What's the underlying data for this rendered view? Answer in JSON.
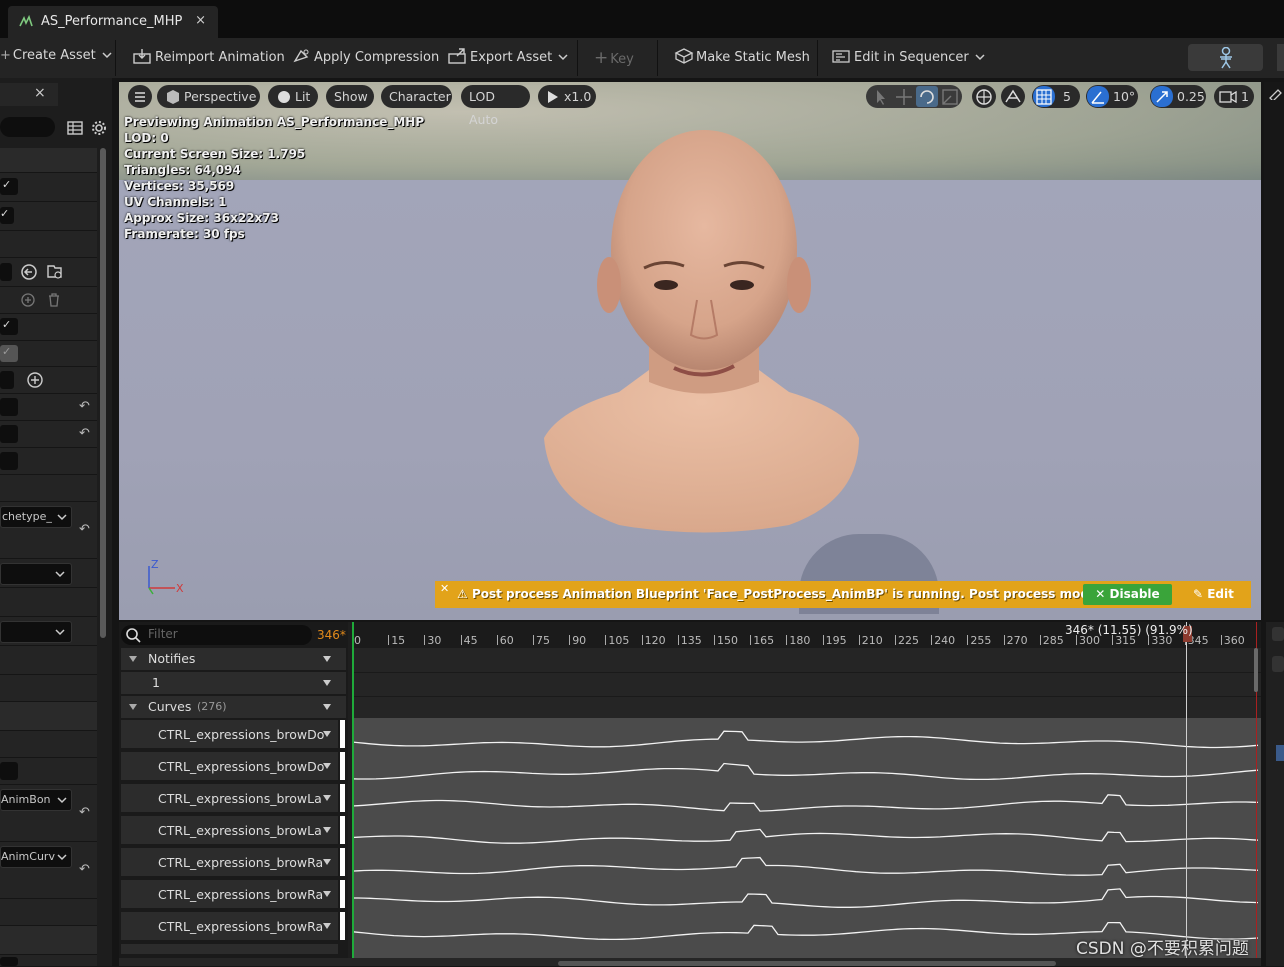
{
  "tab": {
    "title": "AS_Performance_MHP",
    "close": "×"
  },
  "toolbar": {
    "create_asset": "Create Asset",
    "reimport": "Reimport Animation",
    "apply_compression": "Apply Compression",
    "export_asset": "Export Asset",
    "key": "Key",
    "make_static_mesh": "Make Static Mesh",
    "edit_in_sequencer": "Edit in Sequencer"
  },
  "left_panel": {
    "close": "×",
    "dropdown_archetype": "chetype_",
    "dropdown_animbone": "AnimBon ",
    "dropdown_animcurve": "AnimCurv"
  },
  "viewport": {
    "buttons": {
      "perspective": "Perspective",
      "lit": "Lit",
      "show": "Show",
      "character": "Character",
      "lod": "LOD Auto",
      "speed": "x1.0"
    },
    "right_controls": {
      "grid_value": "5",
      "angle_value": "10°",
      "scale_value": "0.25",
      "camera_value": "1"
    },
    "stats": [
      "Previewing Animation AS_Performance_MHP",
      "LOD: 0",
      "Current Screen Size: 1.795",
      "Triangles: 64,094",
      "Vertices: 35,569",
      "UV Channels: 1",
      "Approx Size: 36x22x73",
      "Framerate: 30 fps"
    ],
    "axis": {
      "z": "Z",
      "x": "X"
    },
    "warning": {
      "message": "Post process Animation Blueprint 'Face_PostProcess_AnimBP' is running. Post process modifes curves.",
      "disable": "Disable",
      "edit": "Edit"
    }
  },
  "timeline": {
    "filter_placeholder": "Filter",
    "frame_badge": "346*",
    "playhead_label": "346* (11.55) (91.9%)",
    "ruler_ticks": [
      "0",
      "15",
      "30",
      "45",
      "60",
      "75",
      "90",
      "105",
      "120",
      "135",
      "150",
      "165",
      "180",
      "195",
      "210",
      "225",
      "240",
      "255",
      "270",
      "285",
      "300",
      "315",
      "330",
      "345",
      "360"
    ],
    "notifies_label": "Notifies",
    "notify_track": "1",
    "curves_label": "Curves",
    "curves_count": "(276)",
    "curves": [
      "CTRL_expressions_browDo",
      "CTRL_expressions_browDo",
      "CTRL_expressions_browLa",
      "CTRL_expressions_browLa",
      "CTRL_expressions_browRa",
      "CTRL_expressions_browRa",
      "CTRL_expressions_browRa"
    ]
  },
  "watermark": "CSDN @不要积累问题"
}
